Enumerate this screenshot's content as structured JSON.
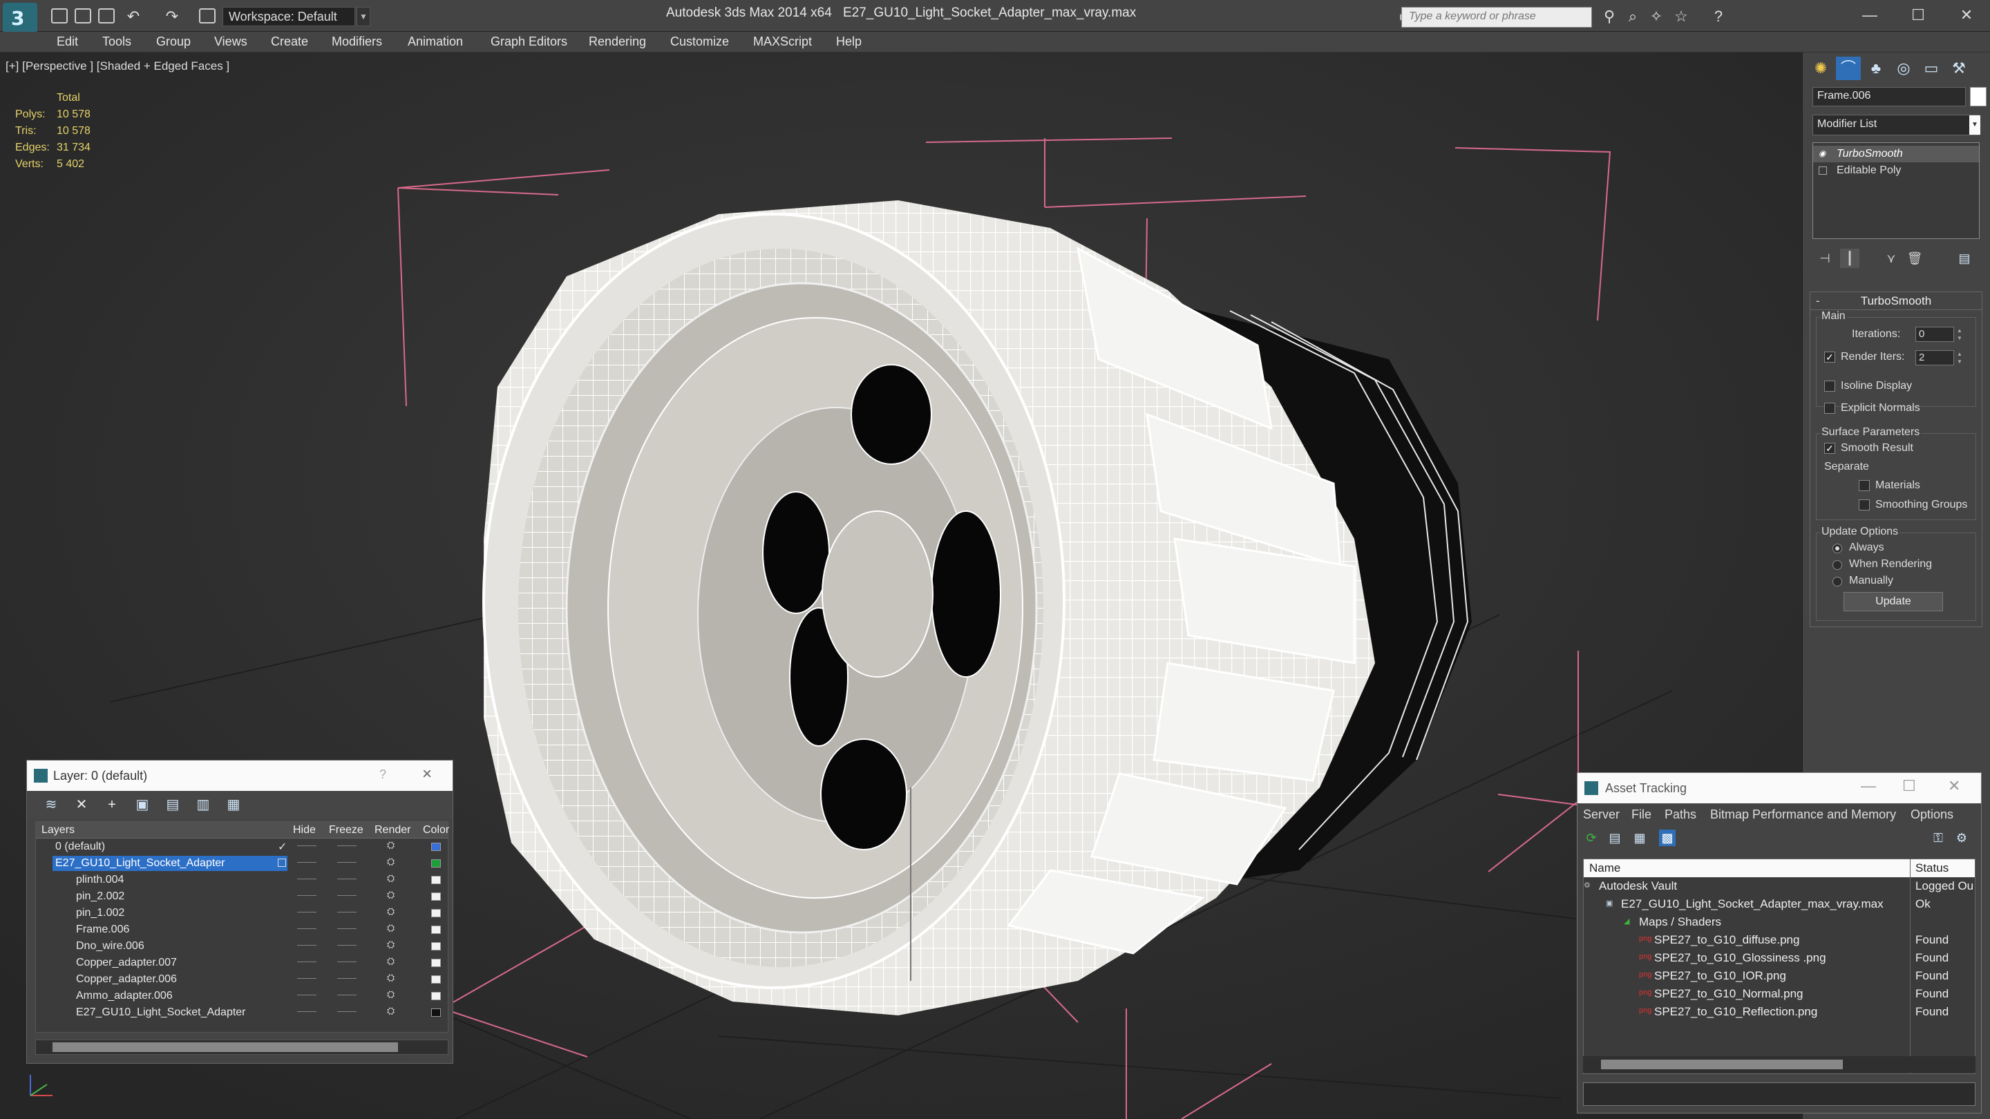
{
  "titlebar": {
    "workspace": "Workspace: Default",
    "app_title": "Autodesk 3ds Max  2014 x64",
    "file_title": "E27_GU10_Light_Socket_Adapter_max_vray.max",
    "search_placeholder": "Type a keyword or phrase"
  },
  "menu": [
    "Edit",
    "Tools",
    "Group",
    "Views",
    "Create",
    "Modifiers",
    "Animation",
    "Graph Editors",
    "Rendering",
    "Customize",
    "MAXScript",
    "Help"
  ],
  "viewport": {
    "label": "[+] [Perspective ] [Shaded + Edged Faces ]",
    "stats_header": "Total",
    "stats": [
      {
        "label": "Polys:",
        "value": "10 578"
      },
      {
        "label": "Tris:",
        "value": "10 578"
      },
      {
        "label": "Edges:",
        "value": "31 734"
      },
      {
        "label": "Verts:",
        "value": "5 402"
      }
    ]
  },
  "layer_dialog": {
    "title": "Layer: 0 (default)",
    "help": "?",
    "close": "×",
    "columns": {
      "layers": "Layers",
      "hide": "Hide",
      "freeze": "Freeze",
      "render": "Render",
      "color": "Color"
    },
    "rows": [
      {
        "name": "0 (default)",
        "swatch": "#3a6fd8"
      },
      {
        "name": "E27_GU10_Light_Socket_Adapter",
        "swatch": "#1e9e3a"
      },
      {
        "name": "plinth.004",
        "swatch": "#f2f2f2"
      },
      {
        "name": "pin_2.002",
        "swatch": "#f2f2f2"
      },
      {
        "name": "pin_1.002",
        "swatch": "#f2f2f2"
      },
      {
        "name": "Frame.006",
        "swatch": "#f2f2f2"
      },
      {
        "name": "Dno_wire.006",
        "swatch": "#f2f2f2"
      },
      {
        "name": "Copper_adapter.007",
        "swatch": "#f2f2f2"
      },
      {
        "name": "Copper_adapter.006",
        "swatch": "#f2f2f2"
      },
      {
        "name": "Ammo_adapter.006",
        "swatch": "#f2f2f2"
      },
      {
        "name": "E27_GU10_Light_Socket_Adapter",
        "swatch": "#111111"
      }
    ]
  },
  "command_panel": {
    "object_name": "Frame.006",
    "modifier_list": "Modifier List",
    "stack": [
      "TurboSmooth",
      "Editable Poly"
    ],
    "rollout_title": "TurboSmooth",
    "main_label": "Main",
    "iterations_label": "Iterations:",
    "iterations_value": "0",
    "render_iters_label": "Render Iters:",
    "render_iters_value": "2",
    "isoline_label": "Isoline Display",
    "explicit_normals_label": "Explicit Normals",
    "surface_params_label": "Surface Parameters",
    "smooth_result_label": "Smooth Result",
    "separate_label": "Separate",
    "materials_label": "Materials",
    "smoothing_groups_label": "Smoothing Groups",
    "update_options_label": "Update Options",
    "always_label": "Always",
    "when_rendering_label": "When Rendering",
    "manually_label": "Manually",
    "update_button": "Update"
  },
  "asset_tracking": {
    "title": "Asset Tracking",
    "menu": [
      "Server",
      "File",
      "Paths",
      "Bitmap Performance and Memory",
      "Options"
    ],
    "col_name": "Name",
    "col_status": "Status",
    "rows": [
      {
        "name": "Autodesk Vault",
        "status": "Logged Ou"
      },
      {
        "name": "E27_GU10_Light_Socket_Adapter_max_vray.max",
        "status": "Ok"
      },
      {
        "name": "Maps / Shaders",
        "status": ""
      },
      {
        "name": "SPE27_to_G10_diffuse.png",
        "status": "Found"
      },
      {
        "name": "SPE27_to_G10_Glossiness .png",
        "status": "Found"
      },
      {
        "name": "SPE27_to_G10_IOR.png",
        "status": "Found"
      },
      {
        "name": "SPE27_to_G10_Normal.png",
        "status": "Found"
      },
      {
        "name": "SPE27_to_G10_Reflection.png",
        "status": "Found"
      }
    ]
  }
}
